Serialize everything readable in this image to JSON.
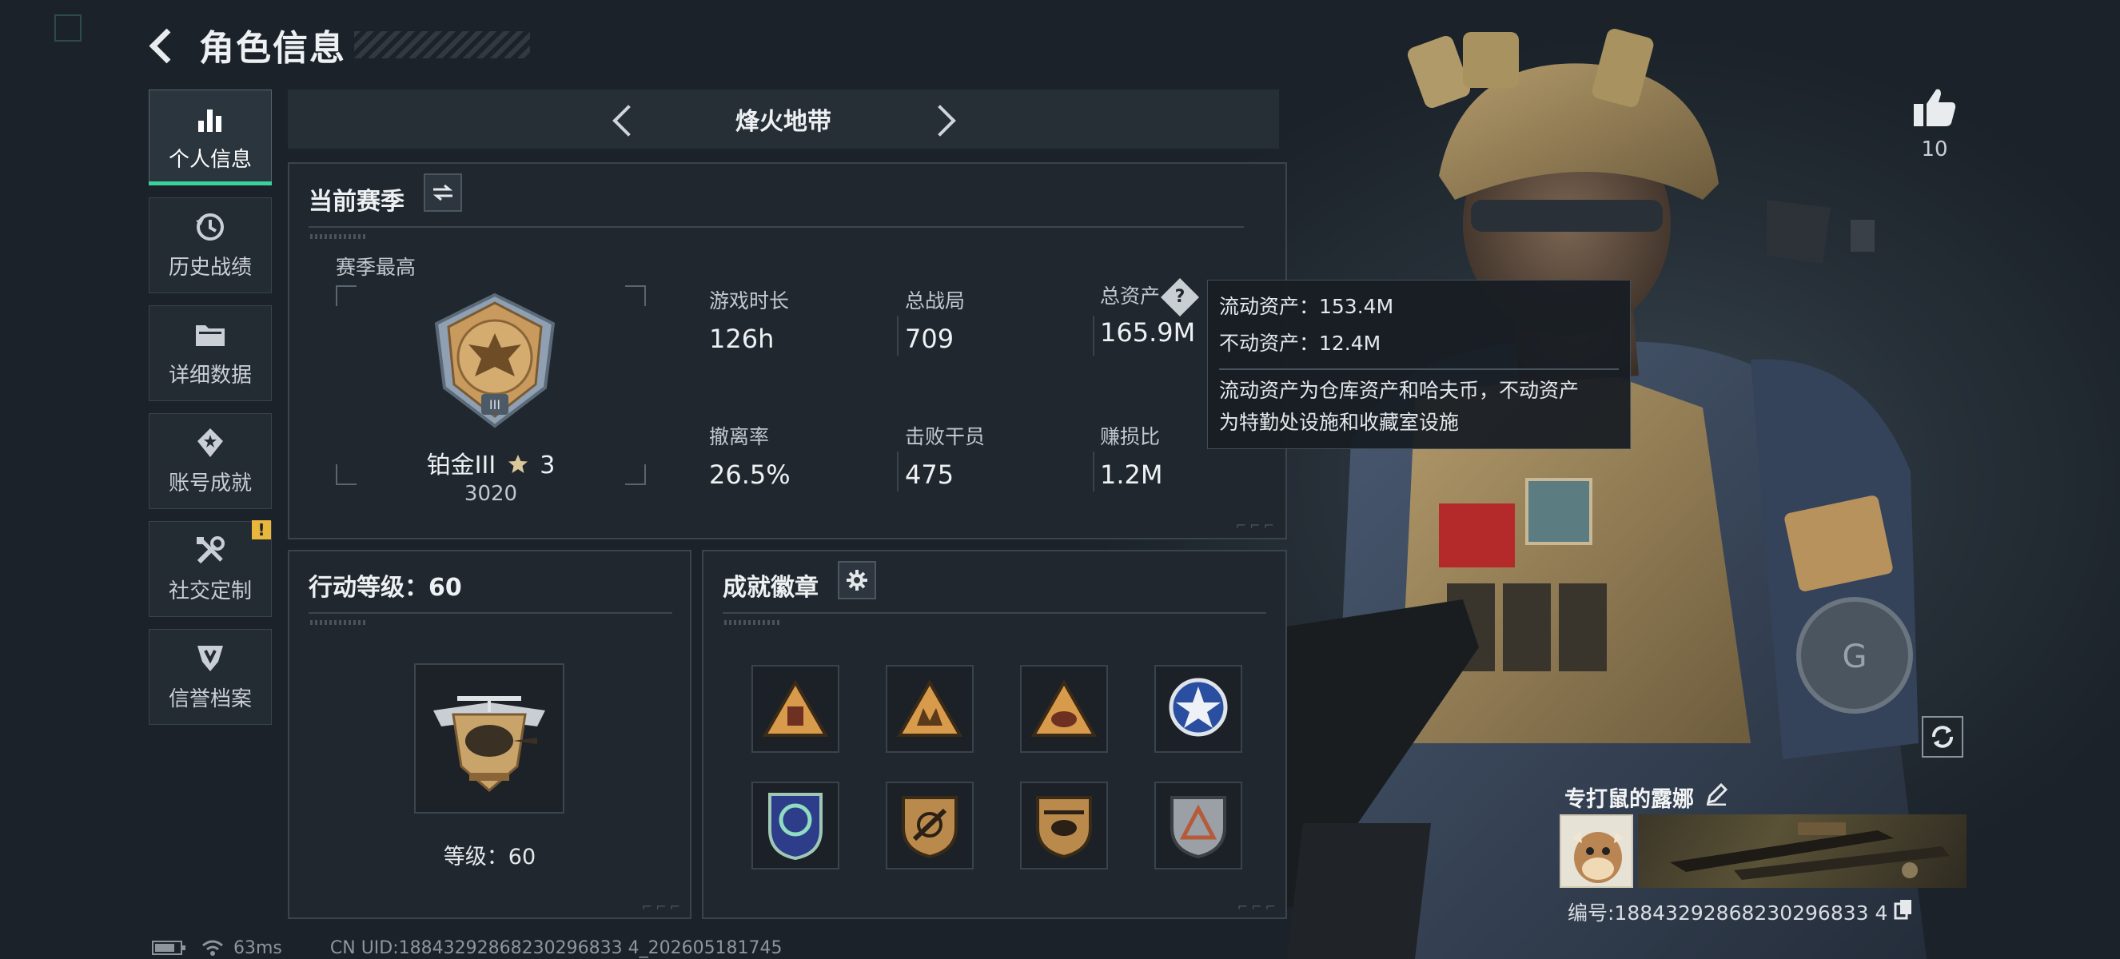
{
  "header": {
    "title": "角色信息"
  },
  "sidebar": {
    "items": [
      {
        "label": "个人信息",
        "icon": "bar-chart-icon",
        "active": true
      },
      {
        "label": "历史战绩",
        "icon": "history-icon"
      },
      {
        "label": "详细数据",
        "icon": "folder-icon"
      },
      {
        "label": "账号成就",
        "icon": "achievement-icon"
      },
      {
        "label": "社交定制",
        "icon": "tools-icon",
        "badge": "!"
      },
      {
        "label": "信誉档案",
        "icon": "credit-shield-icon"
      }
    ]
  },
  "mode_bar": {
    "title": "烽火地带"
  },
  "season": {
    "title": "当前赛季",
    "best_label": "赛季最高",
    "rank_name": "铂金III",
    "rank_stars": "3",
    "rank_score": "3020",
    "stats": [
      {
        "label": "游戏时长",
        "value": "126h"
      },
      {
        "label": "总战局",
        "value": "709"
      },
      {
        "label": "总资产",
        "value": "165.9M"
      },
      {
        "label": "撤离率",
        "value": "26.5%"
      },
      {
        "label": "击败干员",
        "value": "475"
      },
      {
        "label": "赚损比",
        "value": "1.2M"
      }
    ],
    "help_glyph": "?"
  },
  "tooltip": {
    "liquid": "流动资产：153.4M",
    "fixed": "不动资产：12.4M",
    "desc_line1": "流动资产为仓库资产和哈夫币，不动资产",
    "desc_line2": "为特勤处设施和收藏室设施"
  },
  "level": {
    "title": "行动等级：60",
    "level_text": "等级：60"
  },
  "badges": {
    "title": "成就徽章"
  },
  "profile": {
    "likes": "10",
    "name": "专打鼠的露娜",
    "id_text": "编号:18843292868230296833 4"
  },
  "footer": {
    "ping": "63ms",
    "uid": "CN UID:18843292868230296833 4_202605181745"
  },
  "colors": {
    "accent": "#3ad29b",
    "warning": "#e8b73b",
    "gold": "#c8a46a"
  }
}
